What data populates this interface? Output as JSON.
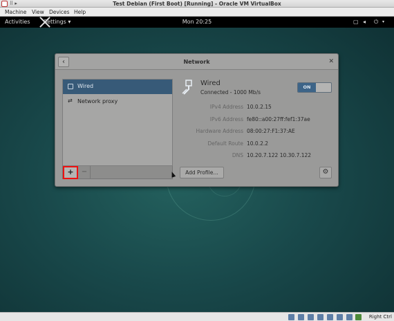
{
  "host": {
    "window_title": "Test Debian (First Boot) [Running] - Oracle VM VirtualBox",
    "menu": [
      "Machine",
      "View",
      "Devices",
      "Help"
    ],
    "host_key": "Right Ctrl"
  },
  "gnome": {
    "activities": "Activities",
    "settings_menu": "Settings ▾",
    "clock": "Mon 20:25"
  },
  "network": {
    "title": "Network",
    "connections": [
      {
        "label": "Wired",
        "selected": true,
        "icon": "network-wired-icon"
      },
      {
        "label": "Network proxy",
        "selected": false,
        "icon": "proxy-icon"
      }
    ],
    "add_button": "+",
    "remove_button": "−",
    "wired_title": "Wired",
    "wired_status": "Connected - 1000 Mb/s",
    "toggle_on": "ON",
    "details": [
      {
        "key": "IPv4 Address",
        "value": "10.0.2.15"
      },
      {
        "key": "IPv6 Address",
        "value": "fe80::a00:27ff:fef1:37ae"
      },
      {
        "key": "Hardware Address",
        "value": "08:00:27:F1:37:AE"
      },
      {
        "key": "Default Route",
        "value": "10.0.2.2"
      },
      {
        "key": "DNS",
        "value": "10.20.7.122 10.30.7.122"
      }
    ],
    "add_profile": "Add Profile…"
  },
  "colors": {
    "selection": "#375a78",
    "highlight_border": "#e11111",
    "topbar": "#000000"
  }
}
